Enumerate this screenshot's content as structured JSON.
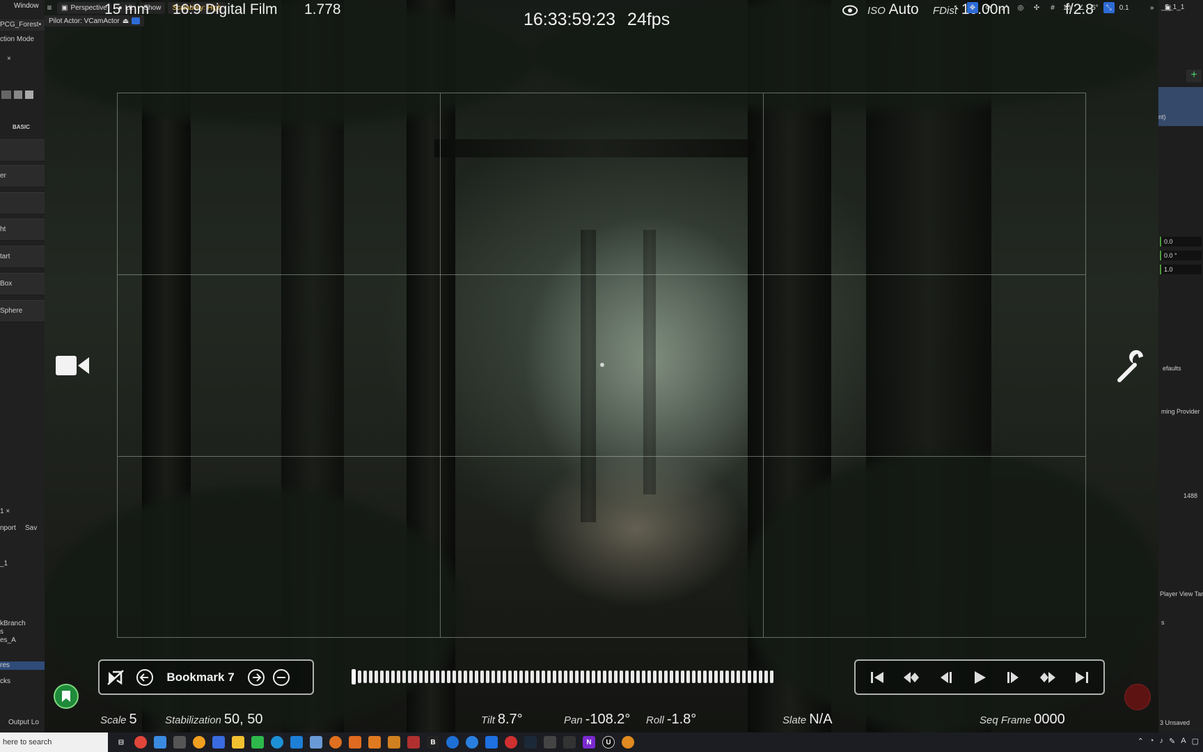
{
  "app": {
    "menu_window": "Window",
    "level_tab": "PCG_Forest•",
    "selection_mode": "ction Mode",
    "basic_label": "BASIC"
  },
  "toolbar": {
    "perspective": "Perspective",
    "lit": "Lit",
    "show": "Show",
    "scalability": "Scalability: High",
    "pilot_actor": "Pilot Actor: VCamActor"
  },
  "vcam": {
    "focal": "15 mm",
    "filmback": "16:9 Digital Film",
    "aspect": "1.778",
    "timecode": "16:33:59:23",
    "fps": "24fps",
    "iso_label": "ISO",
    "iso_value": "Auto",
    "fdist_label": "FDist",
    "fdist_value": "10.00m",
    "fstop": "f/2.8",
    "right_tab": "_5_1_1",
    "grid_snap": "10",
    "rot_snap": "5°",
    "scale_snap": "0.1",
    "bookmark": "Bookmark 7",
    "scale_label": "Scale",
    "scale_value": "5",
    "stab_label": "Stabilization",
    "stab_value": "50, 50",
    "tilt_label": "Tilt",
    "tilt_value": "8.7°",
    "pan_label": "Pan",
    "pan_value": "-108.2°",
    "roll_label": "Roll",
    "roll_value": "-1.8°",
    "slate_label": "Slate",
    "slate_value": "N/A",
    "seq_label": "Seq Frame",
    "seq_value": "0000"
  },
  "left_panel": {
    "items": [
      "er",
      "ht",
      "tart",
      "Box",
      "Sphere"
    ],
    "tab2": "1 ×",
    "import": "nport",
    "save": "Sav",
    "row1": "_1",
    "tree": [
      "kBranch",
      "s",
      "es_A"
    ],
    "selected": "res",
    "last": "cks",
    "output": "Output Lo"
  },
  "right_panel": {
    "fields": [
      "0.0",
      "0.0 °",
      "1.0"
    ],
    "labels": [
      "nt)",
      "efaults",
      "ming Provider",
      "1488",
      "Player View Targ",
      "s",
      "3 Unsaved"
    ]
  },
  "taskbar": {
    "search": "here to search"
  },
  "icons": {
    "camera": "video-camera-icon",
    "wrench": "wrench-icon",
    "eye": "eye-icon",
    "bookmark": "bookmark-icon"
  },
  "colors": {
    "accent_green": "#1f8a3a",
    "record_red": "#5e1313",
    "scalability_yellow": "#f2c14b",
    "selection_blue": "#2f4b78"
  }
}
